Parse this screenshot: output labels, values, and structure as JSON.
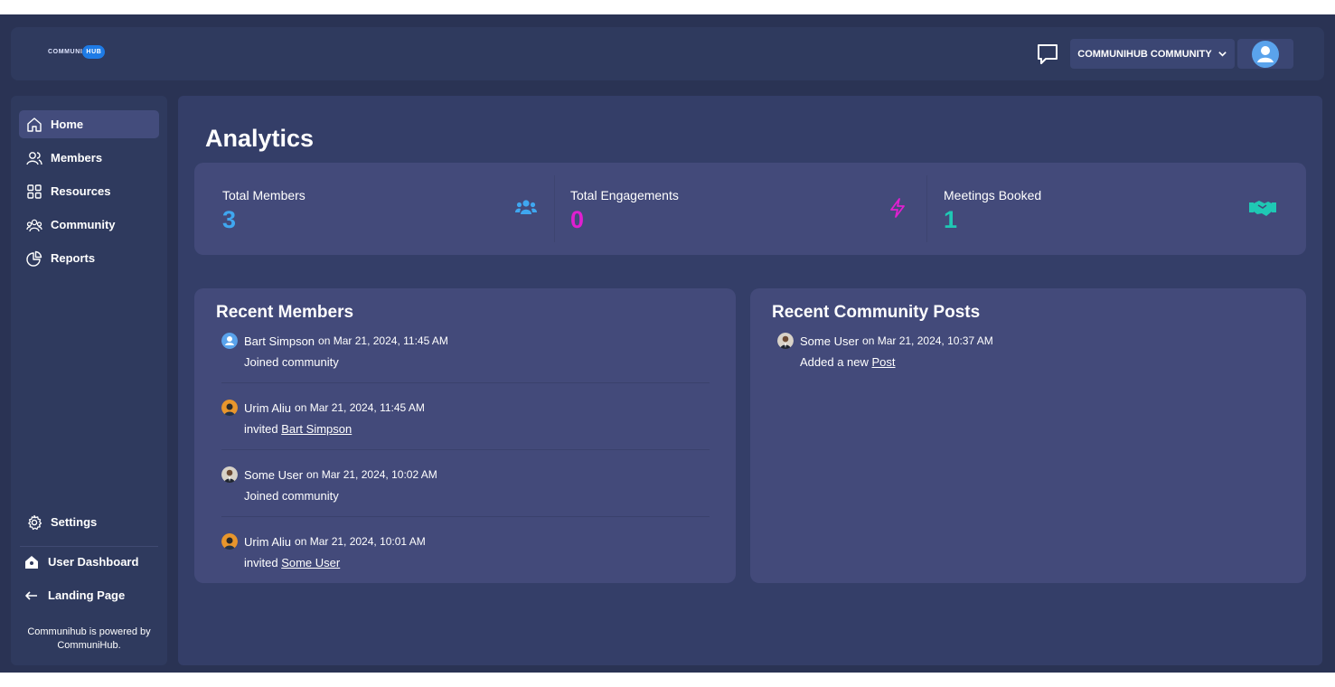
{
  "header": {
    "logo_left": "COMMUNI",
    "logo_right": "HUB",
    "community_label": "COMMUNIHUB COMMUNITY",
    "chat_icon": "chat-bubble-icon",
    "profile_icon": "user-avatar-icon"
  },
  "sidebar": {
    "items": [
      {
        "label": "Home",
        "icon": "home-icon",
        "active": true
      },
      {
        "label": "Members",
        "icon": "members-icon"
      },
      {
        "label": "Resources",
        "icon": "grid-icon"
      },
      {
        "label": "Community",
        "icon": "community-icon"
      },
      {
        "label": "Reports",
        "icon": "pie-chart-icon"
      }
    ],
    "settings_label": "Settings",
    "user_dashboard_label": "User Dashboard",
    "landing_page_label": "Landing Page",
    "powered_by": "Communihub is powered by CommuniHub."
  },
  "main": {
    "title": "Analytics",
    "stats": [
      {
        "label": "Total Members",
        "value": "3",
        "color": "#3fa7f0",
        "icon": "users-icon"
      },
      {
        "label": "Total Engagements",
        "value": "0",
        "color": "#e01fd0",
        "icon": "lightning-icon"
      },
      {
        "label": "Meetings Booked",
        "value": "1",
        "color": "#1fc8b4",
        "icon": "handshake-icon"
      }
    ],
    "recent_members": {
      "title": "Recent Members",
      "items": [
        {
          "name": "Bart Simpson",
          "date": "on Mar 21, 2024, 11:45 AM",
          "action": "Joined community",
          "link": ""
        },
        {
          "name": "Urim Aliu",
          "date": "on Mar 21, 2024, 11:45 AM",
          "action": "invited ",
          "link": "Bart Simpson"
        },
        {
          "name": "Some User",
          "date": "on Mar 21, 2024, 10:02 AM",
          "action": "Joined community",
          "link": ""
        },
        {
          "name": "Urim Aliu",
          "date": "on Mar 21, 2024, 10:01 AM",
          "action": "invited ",
          "link": "Some User"
        }
      ]
    },
    "recent_posts": {
      "title": "Recent Community Posts",
      "items": [
        {
          "name": "Some User",
          "date": "on Mar 21, 2024, 10:37 AM",
          "action": "Added a new ",
          "link": "Post"
        }
      ]
    }
  }
}
